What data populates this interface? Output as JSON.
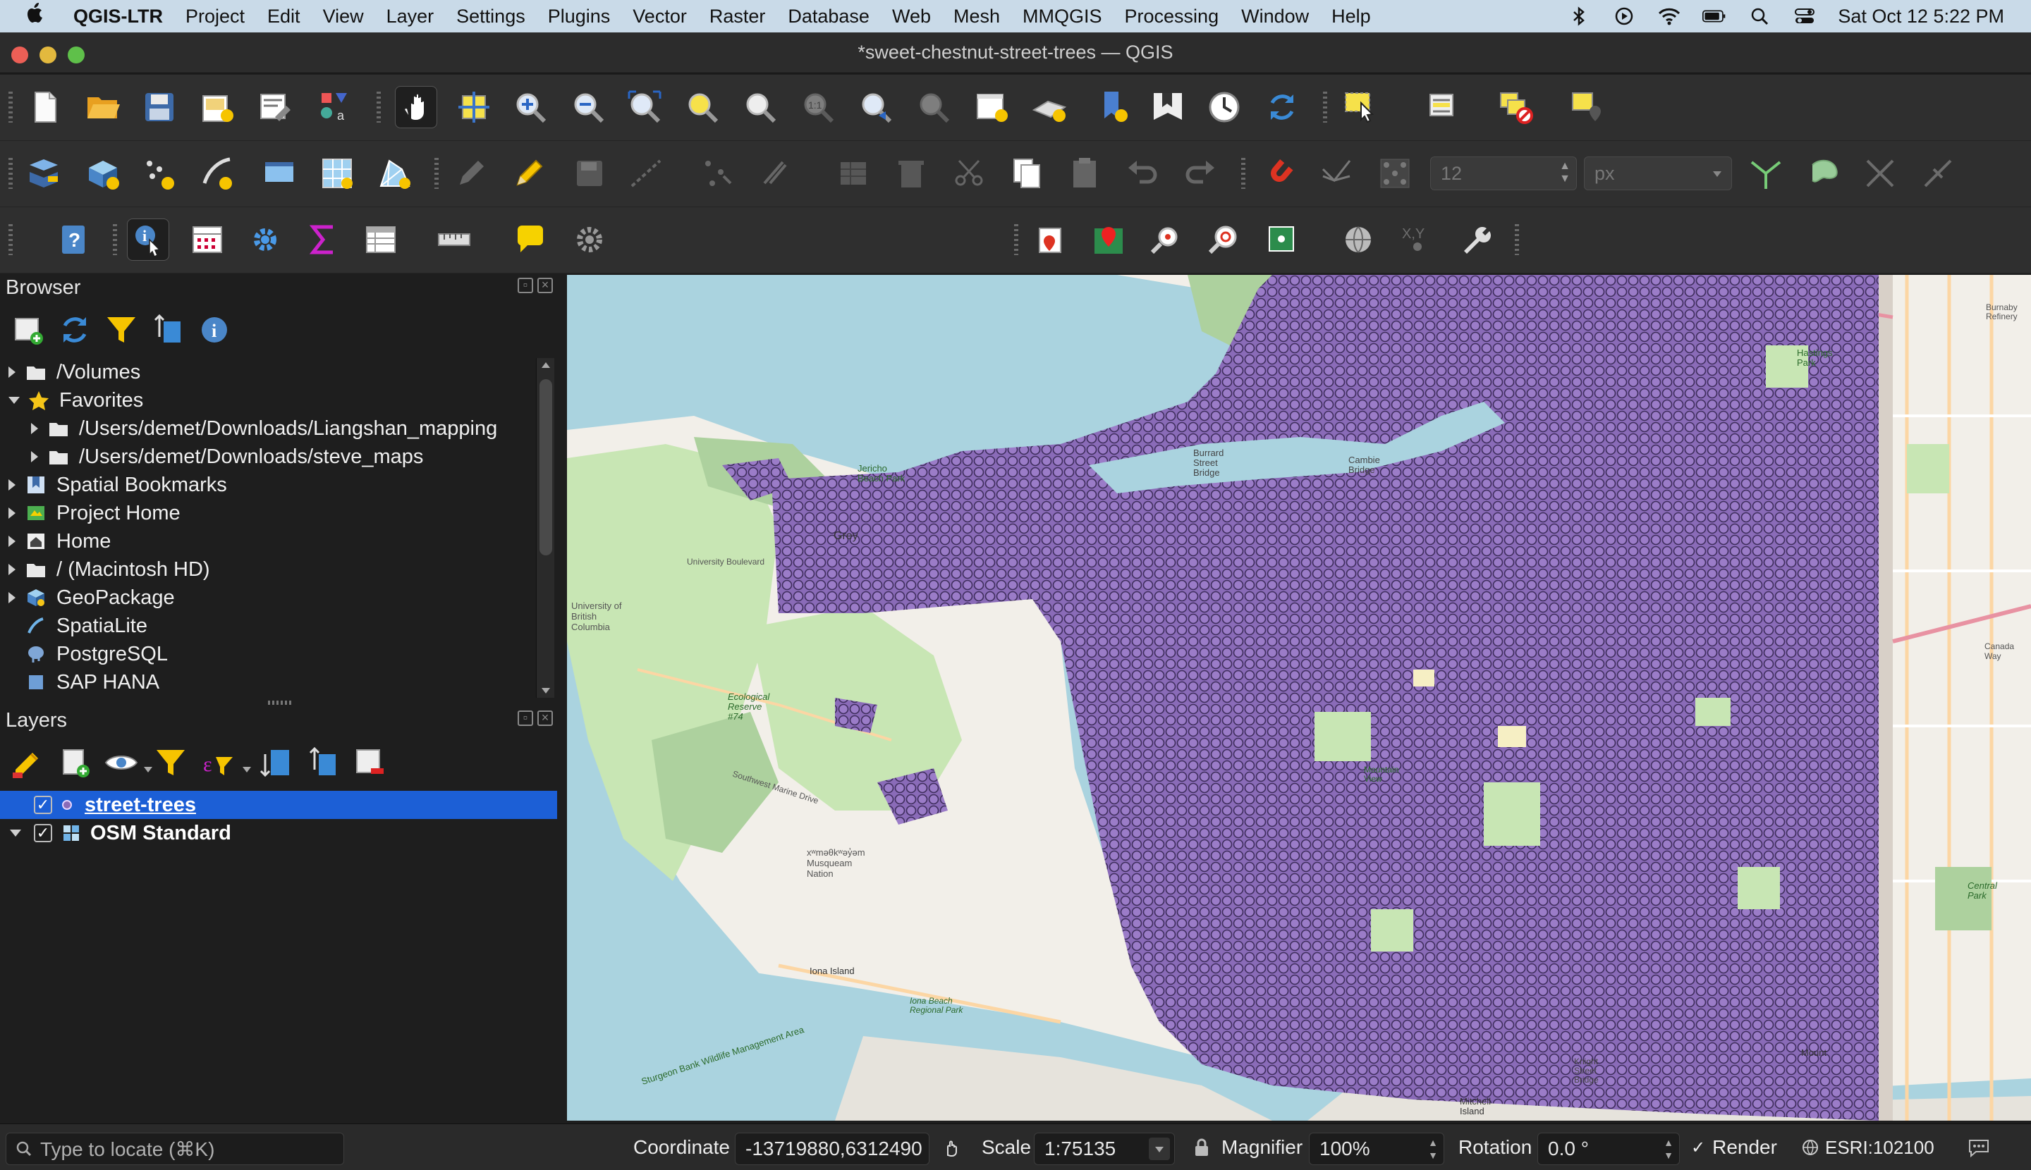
{
  "menubar": {
    "app_name": "QGIS-LTR",
    "items": [
      "Project",
      "Edit",
      "View",
      "Layer",
      "Settings",
      "Plugins",
      "Vector",
      "Raster",
      "Database",
      "Web",
      "Mesh",
      "MMQGIS",
      "Processing",
      "Window",
      "Help"
    ],
    "clock": "Sat Oct 12  5:22 PM"
  },
  "window": {
    "title": "*sweet-chestnut-street-trees — QGIS"
  },
  "toolbar": {
    "snapping_tolerance_value": "12",
    "snapping_units": "px"
  },
  "browser": {
    "title": "Browser",
    "items": [
      {
        "label": "/Volumes",
        "icon": "folder-icon"
      },
      {
        "label": "Favorites",
        "icon": "star-icon"
      },
      {
        "label": "/Users/demet/Downloads/Liangshan_mapping",
        "icon": "folder-icon"
      },
      {
        "label": "/Users/demet/Downloads/steve_maps",
        "icon": "folder-icon"
      },
      {
        "label": "Spatial Bookmarks",
        "icon": "bookmark-icon"
      },
      {
        "label": "Project Home",
        "icon": "project-home-icon"
      },
      {
        "label": "Home",
        "icon": "home-icon"
      },
      {
        "label": "/ (Macintosh HD)",
        "icon": "folder-icon"
      },
      {
        "label": "GeoPackage",
        "icon": "geopackage-icon"
      },
      {
        "label": "SpatiaLite",
        "icon": "spatialite-icon"
      },
      {
        "label": "PostgreSQL",
        "icon": "postgresql-icon"
      },
      {
        "label": "SAP HANA",
        "icon": "sap-hana-icon"
      }
    ]
  },
  "layers": {
    "title": "Layers",
    "items": [
      {
        "label": "street-trees",
        "checked": true,
        "selected": true
      },
      {
        "label": "OSM Standard",
        "checked": true,
        "selected": false
      }
    ]
  },
  "map_labels": {
    "burrard": "Burrard Street Bridge",
    "cambie": "Cambie Bridge",
    "jericho": "Jericho Beach Park",
    "grey": "Grey",
    "ubc": "University of British Columbia",
    "univ_blvd": "University Boulevard",
    "ecological": "Ecological Reserve #74",
    "sw_marine": "Southwest Marine Drive",
    "musqueam": "xʷməθkʷəy̓əm Musqueam Nation",
    "iona": "Iona Island",
    "iona_beach": "Iona Beach Regional Park",
    "sturgeon": "Sturgeon Bank Wildlife Management Area",
    "mitchell": "Mitchell Island",
    "knight": "Knight Street Bridge",
    "hastings": "Hastings Park",
    "burnaby": "Burnaby Refinery",
    "central_park": "Central Park",
    "canada_way": "Canada Way",
    "mountain": "Mountain View",
    "mount": "Mount"
  },
  "statusbar": {
    "locate_placeholder": "Type to locate (⌘K)",
    "coordinate_label": "Coordinate",
    "coordinate_value": "-13719880,6312490",
    "scale_label": "Scale",
    "scale_value": "1:75135",
    "magnifier_label": "Magnifier",
    "magnifier_value": "100%",
    "rotation_label": "Rotation",
    "rotation_value": "0.0 °",
    "render_label": "Render",
    "crs_label": "ESRI:102100"
  },
  "colors": {
    "trees_fill": "#8a6bb8",
    "selection": "#1c5fd6",
    "water": "#aad3df",
    "land": "#f2efe9",
    "park": "#c8e6b4"
  }
}
